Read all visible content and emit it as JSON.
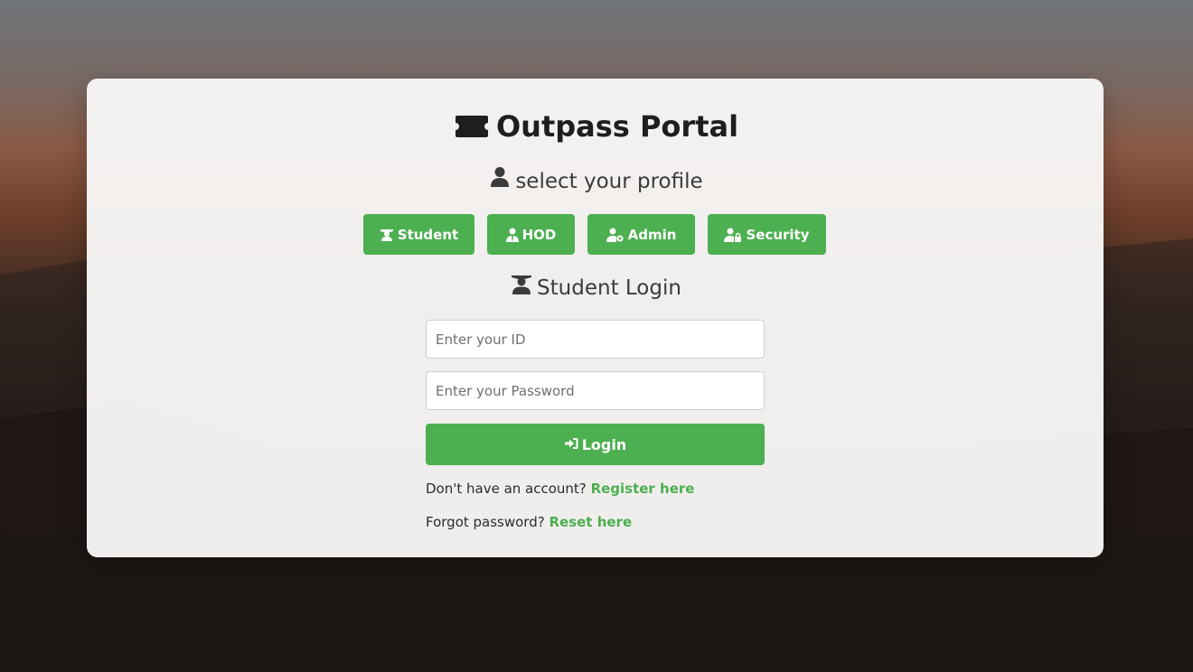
{
  "app": {
    "title": "Outpass Portal",
    "title_icon": "ticket-icon"
  },
  "profile_select": {
    "heading": "select your profile",
    "icon": "user-icon",
    "buttons": [
      {
        "label": "Student",
        "icon": "student-icon"
      },
      {
        "label": "HOD",
        "icon": "user-tie-icon"
      },
      {
        "label": "Admin",
        "icon": "user-gear-icon"
      },
      {
        "label": "Security",
        "icon": "user-lock-icon"
      }
    ]
  },
  "login": {
    "heading": "Student Login",
    "icon": "student-icon",
    "id_placeholder": "Enter your ID",
    "id_value": "",
    "password_placeholder": "Enter your Password",
    "password_value": "",
    "button_label": "Login",
    "button_icon": "sign-in-icon"
  },
  "links": {
    "register_prompt": "Don't have an account?",
    "register_link": "Register here",
    "forgot_prompt": "Forgot password?",
    "forgot_link": "Reset here"
  },
  "colors": {
    "accent": "#4caf50",
    "card_bg": "#f7f6f5",
    "title_text": "#1e1e1e"
  }
}
